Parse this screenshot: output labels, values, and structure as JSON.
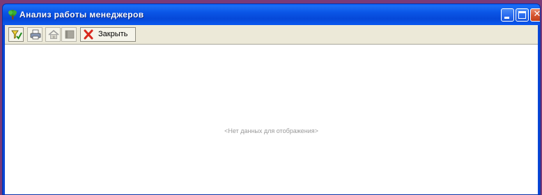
{
  "window": {
    "title": "Анализ работы менеджеров"
  },
  "toolbar": {
    "close_label": "Закрыть",
    "icons": [
      "filter-icon",
      "print-icon",
      "home-icon",
      "book-icon",
      "close-x-icon"
    ]
  },
  "content": {
    "empty_message": "<Нет данных для отображения>"
  },
  "colors": {
    "titlebar": "#0a55e6",
    "toolbar_bg": "#ece9d8",
    "close_x": "#d8281e",
    "desktop": "#7a3a78"
  }
}
